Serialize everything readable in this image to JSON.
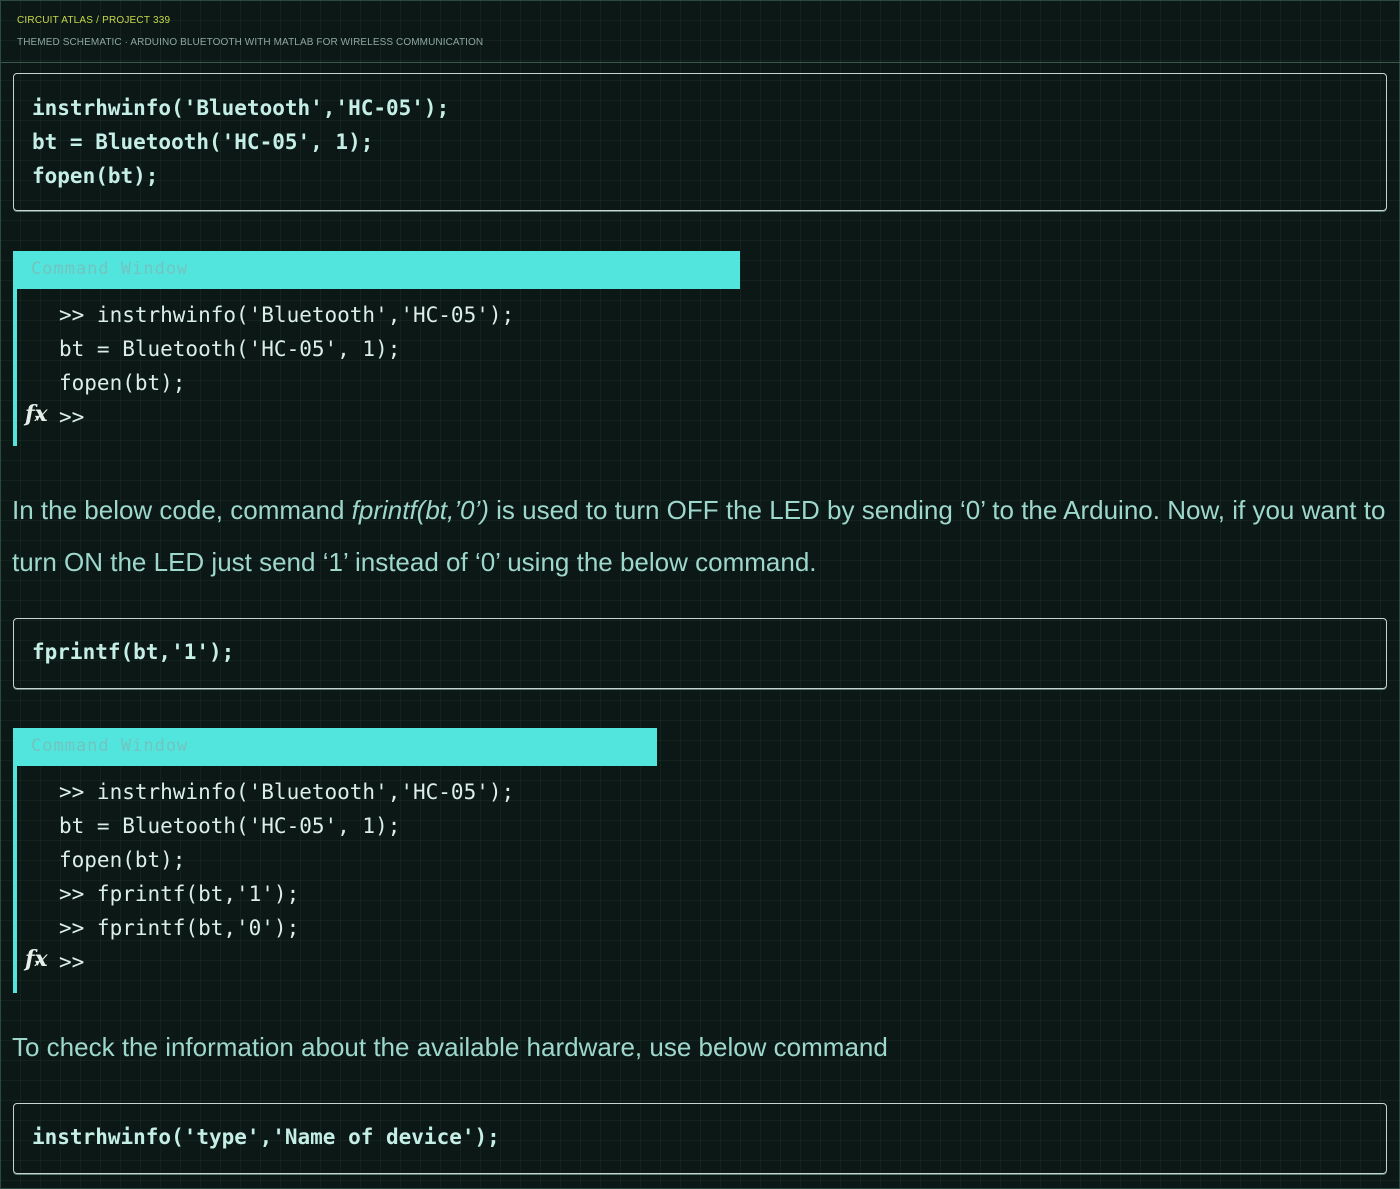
{
  "header": {
    "brand": "CIRCUIT ATLAS / PROJECT 339",
    "subtitle": "THEMED SCHEMATIC · ARDUINO BLUETOOTH WITH MATLAB FOR WIRELESS COMMUNICATION"
  },
  "code_block_1": {
    "lines": [
      "instrhwinfo('Bluetooth','HC-05');",
      "bt = Bluetooth('HC-05', 1);",
      "fopen(bt);"
    ]
  },
  "command_window_1": {
    "title": "Command Window",
    "lines": [
      ">> instrhwinfo('Bluetooth','HC-05');",
      "bt = Bluetooth('HC-05', 1);",
      "fopen(bt);"
    ],
    "prompt": ">>",
    "icon": "fx-icon"
  },
  "paragraph_1": {
    "before": "In the below code, command ",
    "emphasis": "fprintf(bt,’0’)",
    "after": " is used to turn OFF the LED by sending ‘0’ to the Arduino. Now, if you want to turn ON the LED just send ‘1’ instead of ‘0’ using the below command."
  },
  "code_block_2": {
    "lines": [
      "fprintf(bt,'1');"
    ]
  },
  "command_window_2": {
    "title": "Command Window",
    "lines": [
      ">> instrhwinfo('Bluetooth','HC-05');",
      "bt = Bluetooth('HC-05', 1);",
      "fopen(bt);",
      ">> fprintf(bt,'1');",
      ">> fprintf(bt,'0');"
    ],
    "prompt": ">>",
    "icon": "fx-icon"
  },
  "paragraph_2": {
    "text": "To check the information about the available hardware, use below command"
  },
  "code_block_3": {
    "lines": [
      "instrhwinfo('type','Name of device');"
    ]
  },
  "colors": {
    "background": "#0b1815",
    "accent": "#52e5de",
    "brand": "#c8d84a",
    "code_text": "#c5efe6"
  }
}
